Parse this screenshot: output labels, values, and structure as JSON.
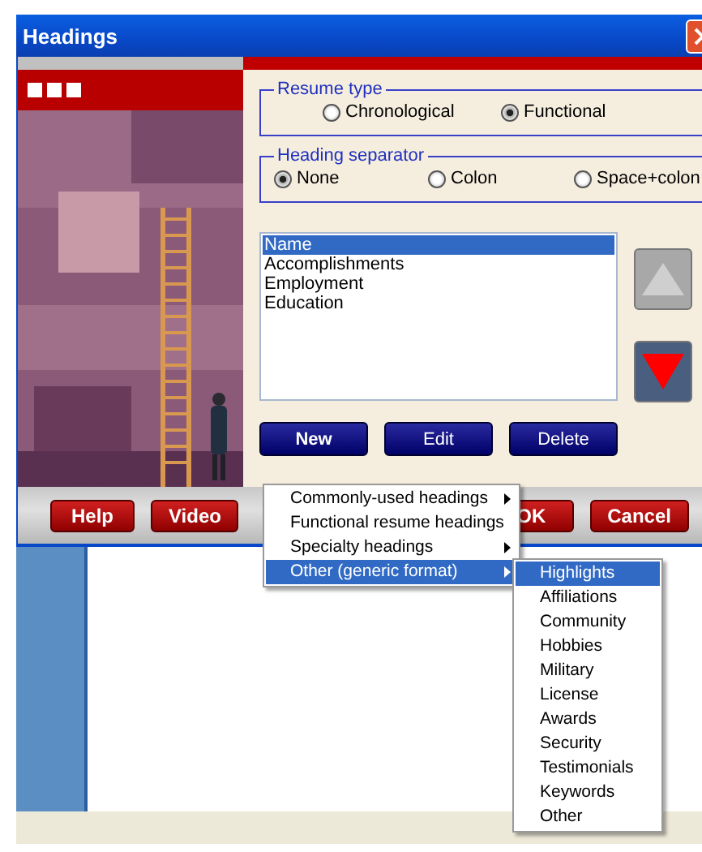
{
  "window": {
    "title": "Headings"
  },
  "resume_type": {
    "label": "Resume type",
    "options": [
      {
        "label": "Chronological",
        "selected": false
      },
      {
        "label": "Functional",
        "selected": true
      }
    ]
  },
  "heading_separator": {
    "label": "Heading separator",
    "options": [
      {
        "label": "None",
        "selected": true
      },
      {
        "label": "Colon",
        "selected": false
      },
      {
        "label": "Space+colon",
        "selected": false
      }
    ]
  },
  "headings_list": [
    {
      "label": "Name",
      "selected": true
    },
    {
      "label": "Accomplishments",
      "selected": false
    },
    {
      "label": "Employment",
      "selected": false
    },
    {
      "label": "Education",
      "selected": false
    }
  ],
  "move_buttons": [
    {
      "kind": "up",
      "disabled": true
    },
    {
      "kind": "down",
      "disabled": false
    }
  ],
  "list_buttons": [
    {
      "label": "New",
      "selected": true
    },
    {
      "label": "Edit",
      "selected": false
    },
    {
      "label": "Delete",
      "selected": false
    }
  ],
  "footer_buttons_left": [
    "Help",
    "Video"
  ],
  "footer_buttons_right": [
    "OK",
    "Cancel"
  ],
  "new_menu": [
    {
      "label": "Commonly-used headings",
      "selected": false
    },
    {
      "label": "Functional resume headings",
      "selected": false
    },
    {
      "label": "Specialty headings",
      "selected": false
    },
    {
      "label": "Other (generic format)",
      "selected": true
    }
  ],
  "submenu": [
    {
      "label": "Highlights",
      "selected": true
    },
    {
      "label": "Affiliations",
      "selected": false
    },
    {
      "label": "Community",
      "selected": false
    },
    {
      "label": "Hobbies",
      "selected": false
    },
    {
      "label": "Military",
      "selected": false
    },
    {
      "label": "License",
      "selected": false
    },
    {
      "label": "Awards",
      "selected": false
    },
    {
      "label": "Security",
      "selected": false
    },
    {
      "label": "Testimonials",
      "selected": false
    },
    {
      "label": "Keywords",
      "selected": false
    },
    {
      "label": "Other",
      "selected": false
    }
  ]
}
